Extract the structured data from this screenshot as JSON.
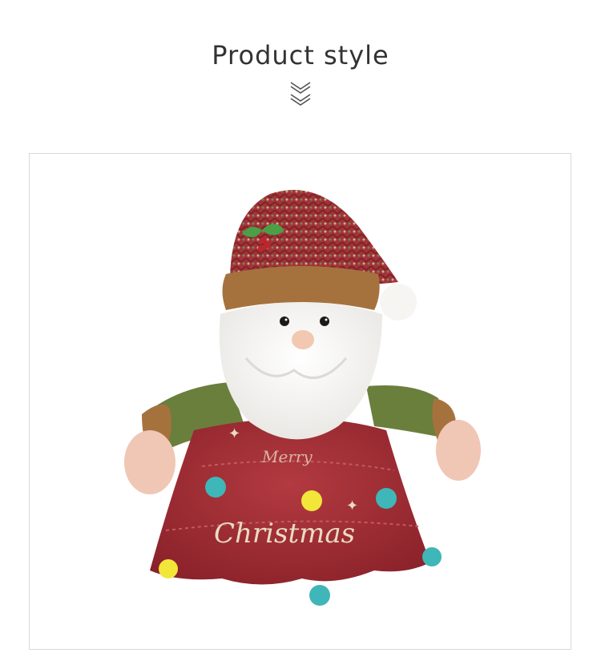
{
  "section": {
    "title": "Product style"
  },
  "photo": {
    "embroidery_text": "Christmas",
    "embroidery_top_text": "Merry",
    "colors": {
      "dress_red": "#9e2a31",
      "hat_red": "#a3323a",
      "hat_green": "#6d8a4a",
      "beard_white": "#f7f5f2",
      "sleeve_green": "#6b7f3d",
      "fur_brown": "#a5723e",
      "skin": "#f0c6b5",
      "pom_teal": "#3fb6b8",
      "pom_yellow": "#f3e63b"
    }
  }
}
